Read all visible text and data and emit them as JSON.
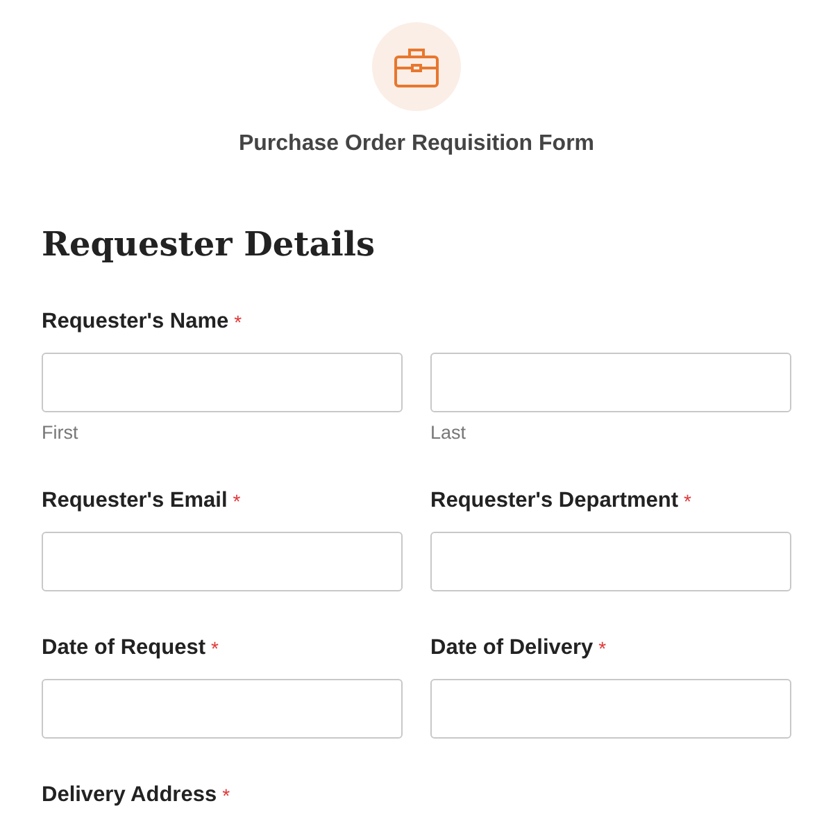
{
  "form": {
    "title": "Purchase Order Requisition Form"
  },
  "section": {
    "heading": "Requester Details"
  },
  "rows": [
    {
      "fields": [
        {
          "kind": "pair",
          "label": "Requester's Name",
          "asterisk": "*",
          "sublabels": [
            "First",
            "Last"
          ]
        }
      ]
    },
    {
      "fields": [
        {
          "kind": "text",
          "label": "Requester's Email",
          "asterisk": "*"
        },
        {
          "kind": "text",
          "label": "Requester's Department",
          "asterisk": "*"
        }
      ]
    },
    {
      "fields": [
        {
          "kind": "text",
          "label": "Date of Request",
          "asterisk": "*"
        },
        {
          "kind": "text",
          "label": "Date of Delivery",
          "asterisk": "*"
        }
      ]
    },
    {
      "fields": [
        {
          "kind": "label_only",
          "label": "Delivery Address",
          "asterisk": "*"
        }
      ]
    }
  ]
}
